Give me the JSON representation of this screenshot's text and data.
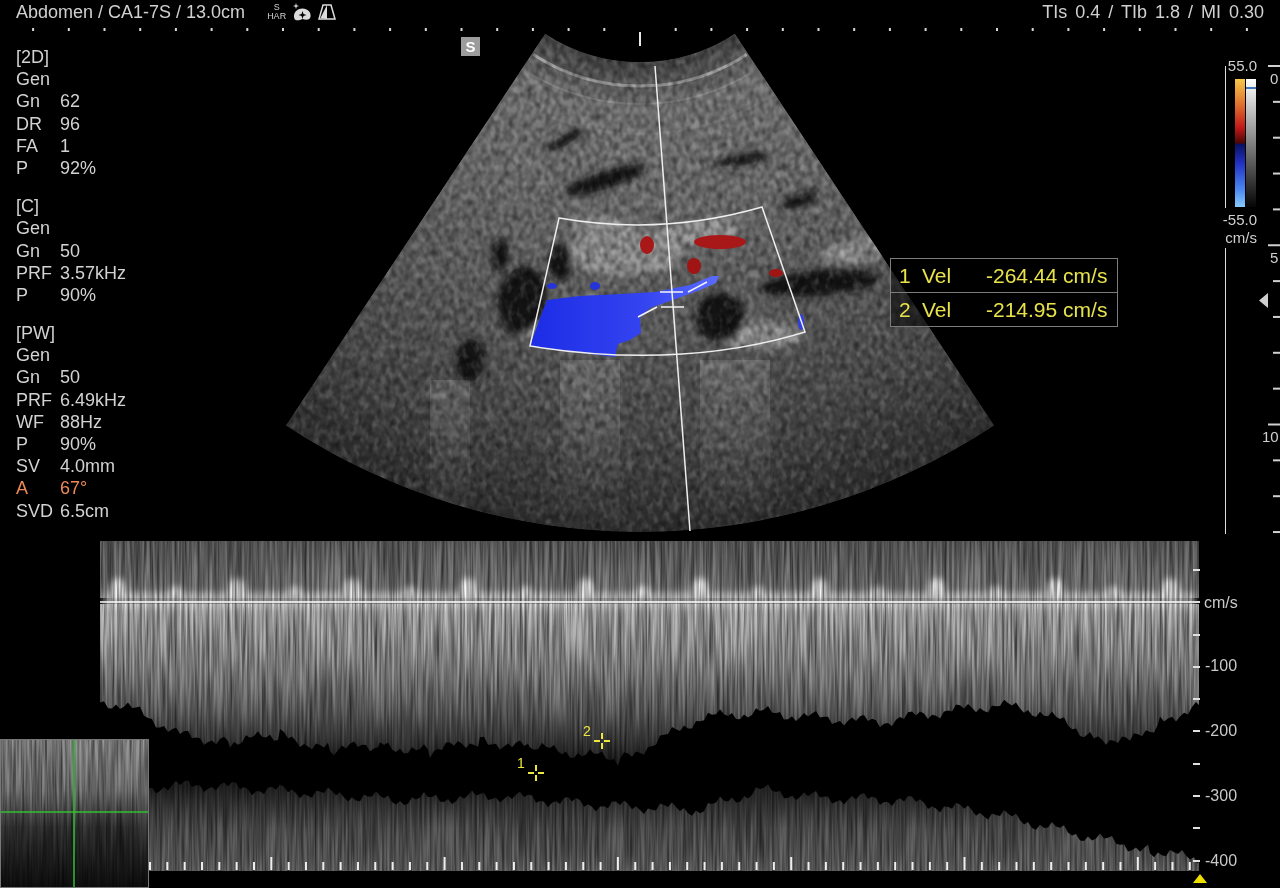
{
  "header": {
    "title": "Abdomen / CA1-7S / 13.0cm",
    "harmonic_label": {
      "top": "S",
      "bottom": "HAR"
    },
    "indices": "TIs 0.4 / TIb 1.8 / MI 0.30"
  },
  "image": {
    "orientation_marker": "S"
  },
  "params": [
    {
      "heading": "[2D]",
      "rows": [
        {
          "label": "Gen",
          "highlighted": false
        },
        {
          "label": "Gn",
          "value": "62",
          "highlighted": false
        },
        {
          "label": "DR",
          "value": "96",
          "highlighted": false
        },
        {
          "label": "FA",
          "value": "1",
          "highlighted": false
        },
        {
          "label": "P",
          "value": "92%",
          "highlighted": false
        }
      ]
    },
    {
      "heading": "[C]",
      "rows": [
        {
          "label": "Gen",
          "highlighted": false
        },
        {
          "label": "Gn",
          "value": "50",
          "highlighted": false
        },
        {
          "label": "PRF",
          "value": "3.57kHz",
          "highlighted": false
        },
        {
          "label": "P",
          "value": "90%",
          "highlighted": false
        }
      ]
    },
    {
      "heading": "[PW]",
      "rows": [
        {
          "label": "Gen",
          "highlighted": false
        },
        {
          "label": "Gn",
          "value": "50",
          "highlighted": false
        },
        {
          "label": "PRF",
          "value": "6.49kHz",
          "highlighted": false
        },
        {
          "label": "WF",
          "value": "88Hz",
          "highlighted": false
        },
        {
          "label": "P",
          "value": "90%",
          "highlighted": false
        },
        {
          "label": "SV",
          "value": "4.0mm",
          "highlighted": false
        },
        {
          "label": "A",
          "value": "67°",
          "highlighted": true
        },
        {
          "label": "SVD",
          "value": "6.5cm",
          "highlighted": false
        }
      ]
    }
  ],
  "measurements": [
    {
      "index": "1",
      "name": "Vel",
      "value": "-264.44 cm/s"
    },
    {
      "index": "2",
      "name": "Vel",
      "value": "-214.95 cm/s"
    }
  ],
  "color_scale": {
    "max": "55.0",
    "min": "-55.0",
    "unit": "cm/s"
  },
  "depth_scale": {
    "labels": [
      "0",
      "5",
      "10"
    ]
  },
  "spectrum": {
    "unit": "cm/s",
    "labels": [
      "-100",
      "-200",
      "-300",
      "-400"
    ],
    "calipers": [
      "1",
      "2"
    ]
  }
}
